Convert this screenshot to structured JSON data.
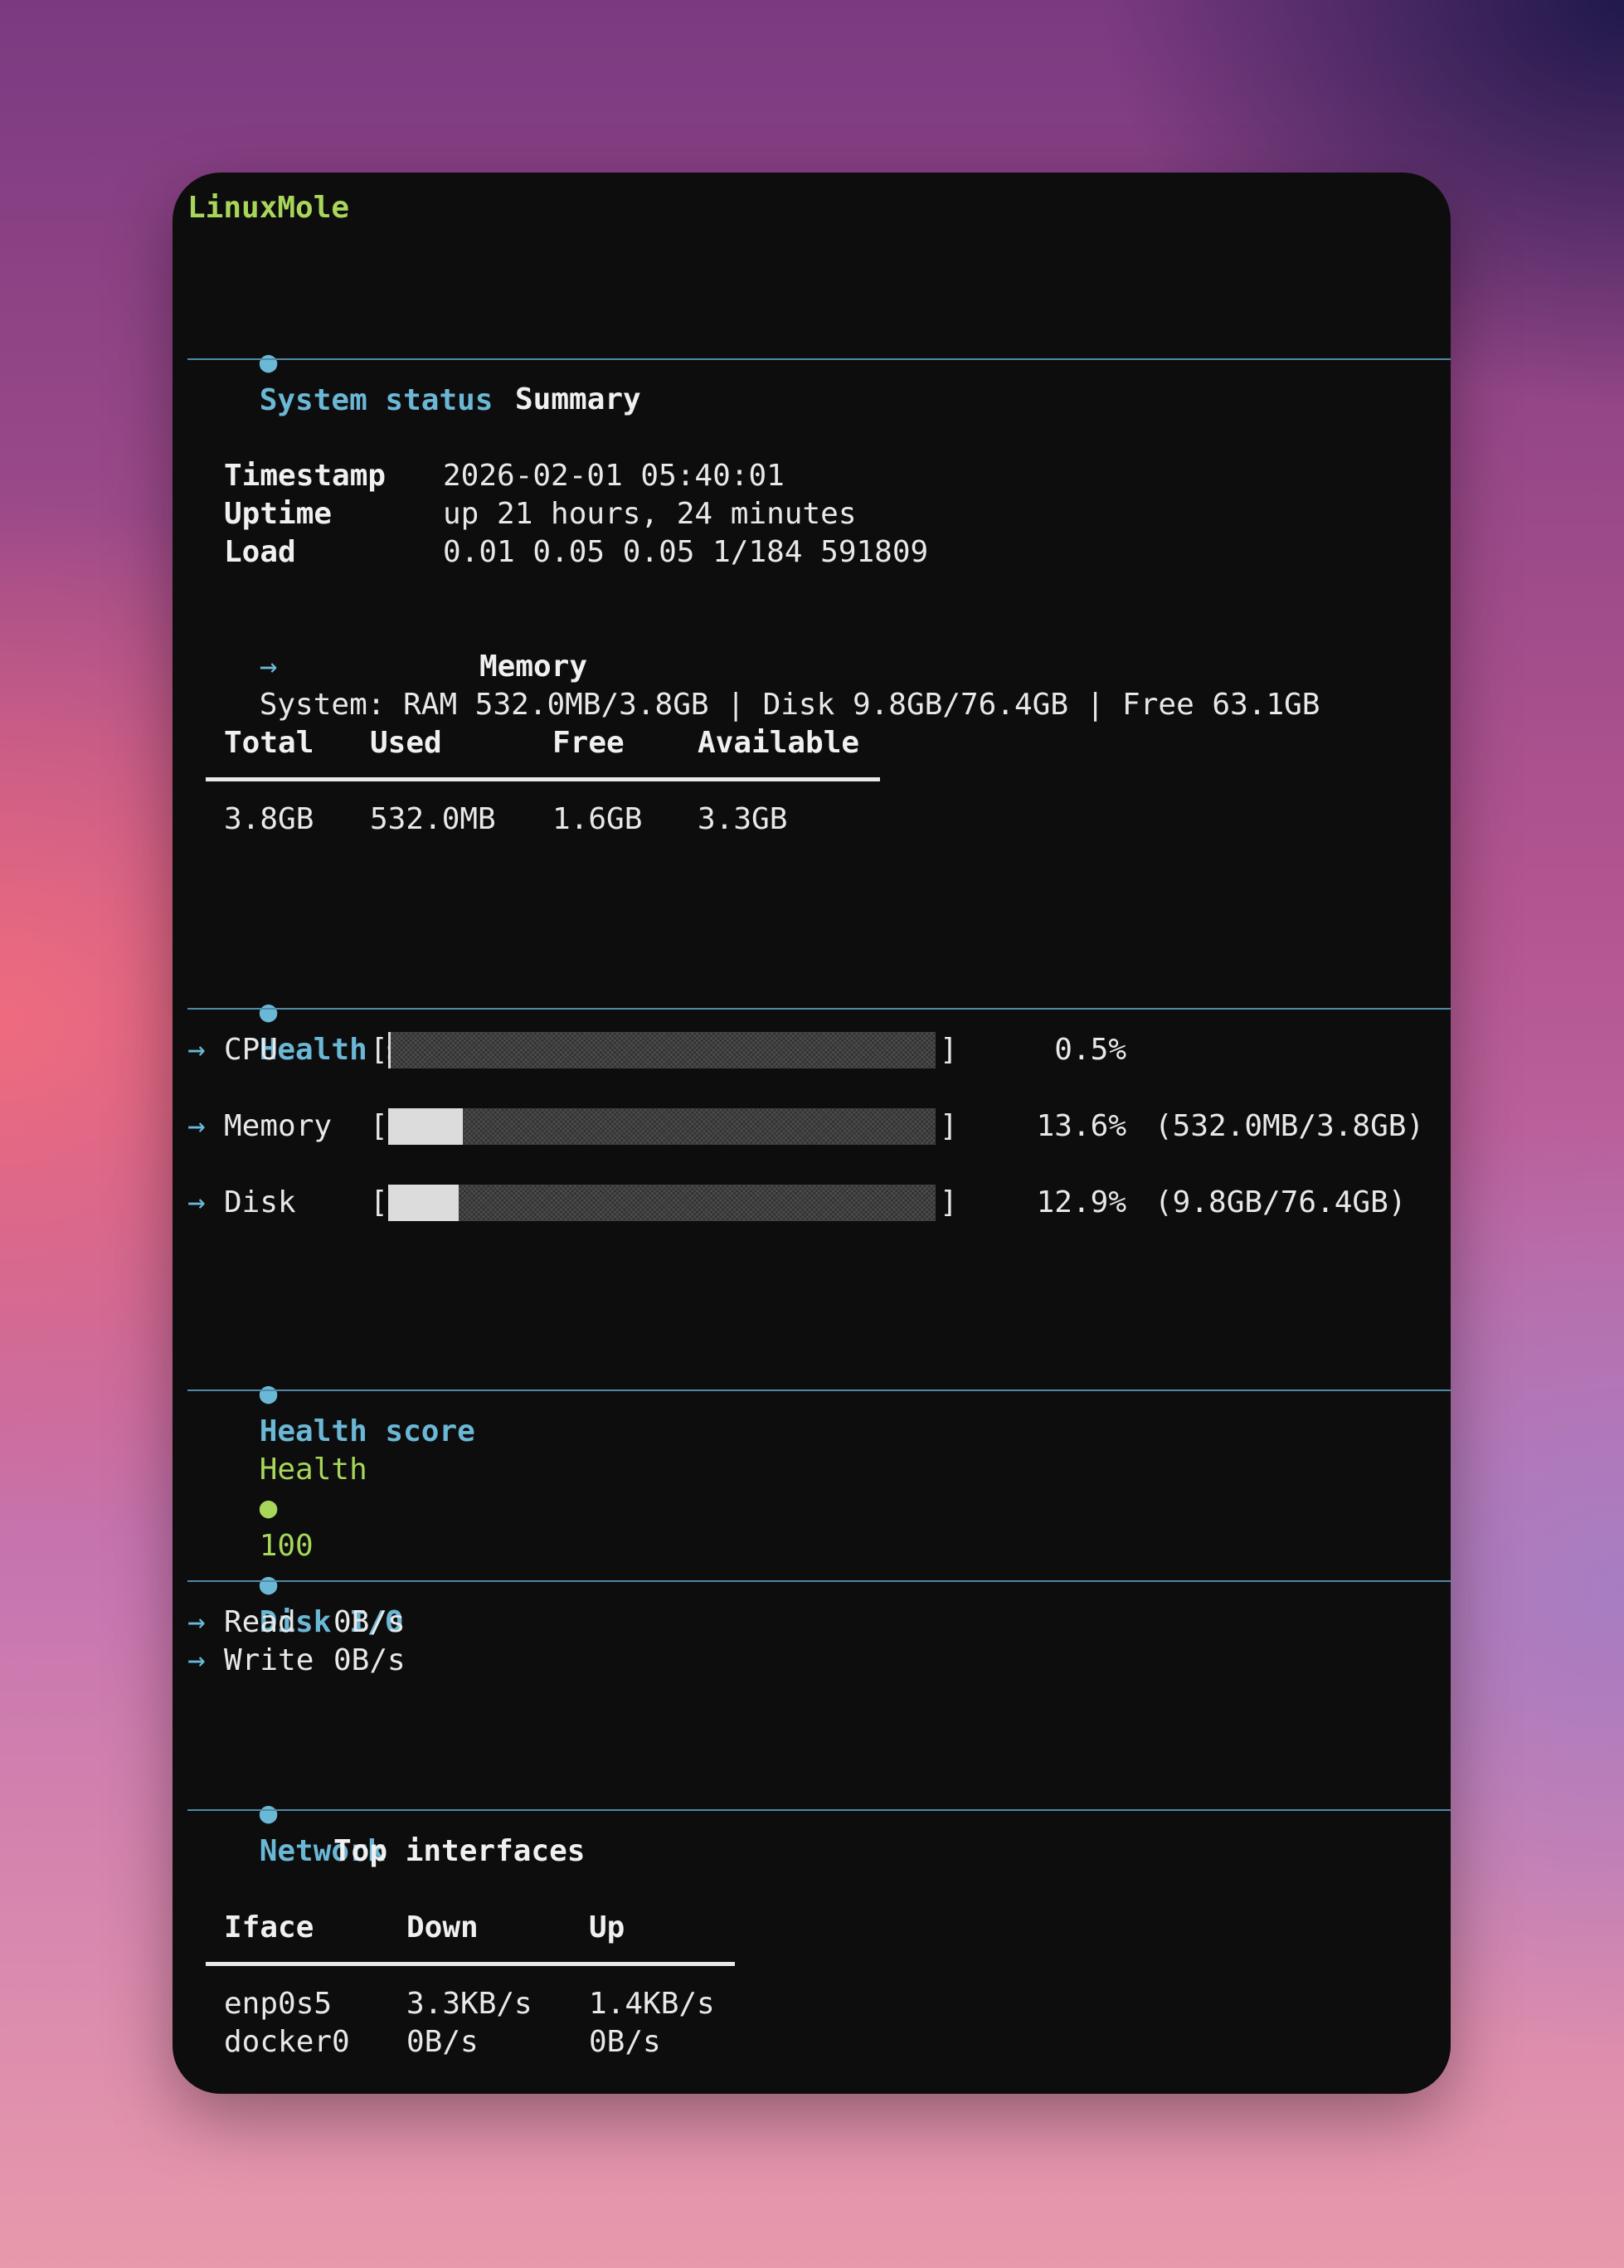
{
  "app_title": "LinuxMole",
  "bullet_glyph": "●",
  "arrow_glyph": "→",
  "colors": {
    "accent_blue": "#6ab7d6",
    "accent_green": "#a8d65a",
    "window_bg": "#0d0d0d",
    "text": "#e8e8e8"
  },
  "system_status": {
    "title": "System status",
    "summary_heading": "Summary",
    "rows": [
      {
        "label": "Timestamp",
        "value": "2026-02-01 05:40:01"
      },
      {
        "label": "Uptime",
        "value": "up 21 hours, 24 minutes"
      },
      {
        "label": "Load",
        "value": "0.01 0.05 0.05 1/184 591809"
      }
    ],
    "system_line": "System: RAM 532.0MB/3.8GB | Disk 9.8GB/76.4GB | Free 63.1GB",
    "memory_heading": "Memory",
    "memory_table": {
      "headers": [
        "Total",
        "Used",
        "Free",
        "Available"
      ],
      "values": [
        "3.8GB",
        "532.0MB",
        "1.6GB",
        "3.3GB"
      ]
    }
  },
  "health_snapshot": {
    "title": "Health snapshot",
    "bracket_open": "[",
    "bracket_close": "]",
    "rows": [
      {
        "label": "CPU",
        "fraction": 0.005,
        "percent": "0.5%",
        "detail": ""
      },
      {
        "label": "Memory",
        "fraction": 0.136,
        "percent": "13.6%",
        "detail": "(532.0MB/3.8GB)"
      },
      {
        "label": "Disk",
        "fraction": 0.129,
        "percent": "12.9%",
        "detail": "(9.8GB/76.4GB)"
      }
    ]
  },
  "health_score": {
    "title": "Health score",
    "label": "Health",
    "value": "100"
  },
  "disk_io": {
    "title": "Disk I/O",
    "rows": [
      {
        "label": "Read",
        "value": "0B/s"
      },
      {
        "label": "Write",
        "value": "0B/s"
      }
    ]
  },
  "network": {
    "title": "Network",
    "top_heading": "Top interfaces",
    "headers": [
      "Iface",
      "Down",
      "Up"
    ],
    "rows": [
      [
        "enp0s5",
        "3.3KB/s",
        "1.4KB/s"
      ],
      [
        "docker0",
        "0B/s",
        "0B/s"
      ]
    ]
  }
}
